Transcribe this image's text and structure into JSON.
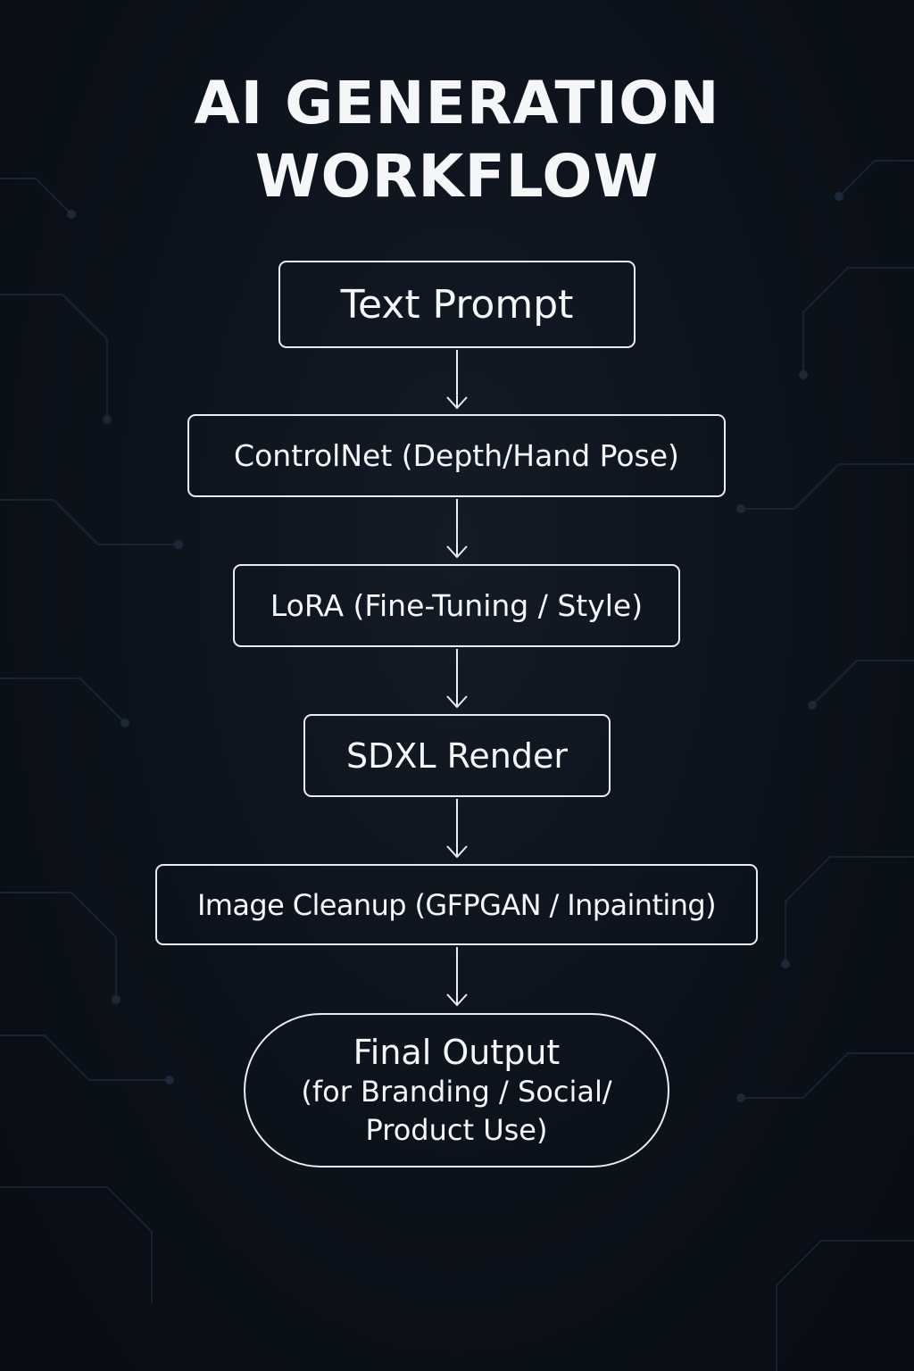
{
  "title": {
    "line1": "AI GENERATION",
    "line2": "WORKFLOW"
  },
  "steps": [
    {
      "label": "Text Prompt"
    },
    {
      "label": "ControlNet (Depth/Hand Pose)"
    },
    {
      "label": "LoRA (Fine-Tuning / Style)"
    },
    {
      "label": "SDXL Render"
    },
    {
      "label": "Image Cleanup (GFPGAN / Inpainting)"
    }
  ],
  "final_output": {
    "label": "Final Output",
    "detail_line1": "(for Branding / Social/",
    "detail_line2": "Product Use)"
  },
  "colors": {
    "background": "#0c121b",
    "stroke": "#e9edf2",
    "text": "#f4f6f8"
  }
}
